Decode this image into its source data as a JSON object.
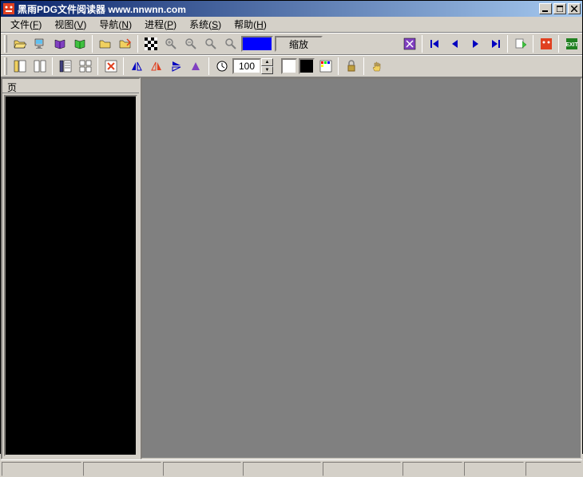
{
  "titlebar": {
    "title": "黑雨PDG文件阅读器 www.nnwnn.com"
  },
  "menu": {
    "file": {
      "label": "文件",
      "key": "F"
    },
    "view": {
      "label": "视图",
      "key": "V"
    },
    "nav": {
      "label": "导航",
      "key": "N"
    },
    "process": {
      "label": "进程",
      "key": "P"
    },
    "system": {
      "label": "系统",
      "key": "S"
    },
    "help": {
      "label": "帮助",
      "key": "H"
    }
  },
  "toolbar1": {
    "zoom_label": "缩放",
    "color_value": "#0000ff"
  },
  "toolbar2": {
    "page_value": "100",
    "fg_color": "#ffffff",
    "bg_color": "#000000"
  },
  "sidepanel": {
    "tab_label": "页"
  },
  "statusbar": {
    "cells": [
      100,
      98,
      98,
      98,
      98,
      75,
      75,
      80
    ]
  }
}
